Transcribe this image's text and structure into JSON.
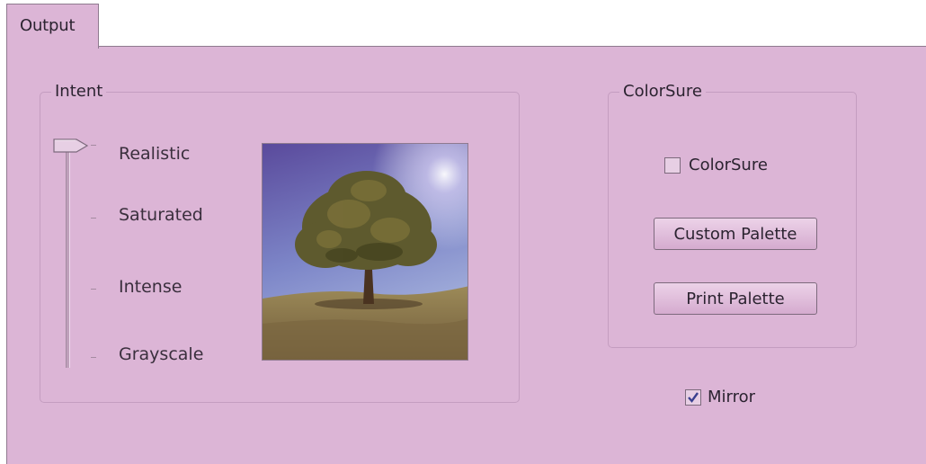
{
  "tabs": [
    {
      "label": "Output",
      "selected": true
    }
  ],
  "intent": {
    "legend": "Intent",
    "levels": [
      "Realistic",
      "Saturated",
      "Intense",
      "Grayscale"
    ],
    "selected": "Realistic",
    "preview_image": "tree-landscape-preview"
  },
  "colorsure": {
    "legend": "ColorSure",
    "checkbox_label": "ColorSure",
    "checkbox_checked": false,
    "custom_palette_label": "Custom Palette",
    "print_palette_label": "Print Palette"
  },
  "mirror": {
    "label": "Mirror",
    "checked": true
  },
  "colors": {
    "background": "#dcb5d6",
    "border": "#8f7a8f"
  }
}
